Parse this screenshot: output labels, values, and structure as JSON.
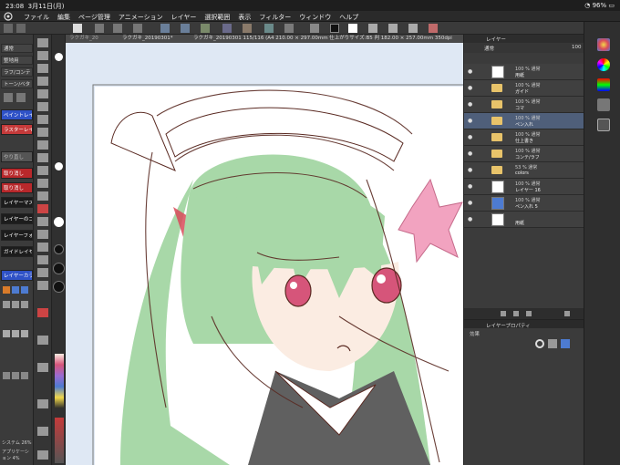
{
  "status": {
    "time": "23:08",
    "date": "3月11日(月)",
    "battery": "96%"
  },
  "menu": [
    "ファイル",
    "編集",
    "ページ管理",
    "アニメーション",
    "レイヤー",
    "選択範囲",
    "表示",
    "フィルター",
    "ウィンドウ",
    "ヘルプ"
  ],
  "left_panel": {
    "rows": [
      "通常",
      "整地用",
      "ラフ/コンテ",
      "トーン/ベタ"
    ],
    "buttons": [
      {
        "label": "ペイントレイヤー",
        "bg": "#2f52c7",
        "fg": "#ffffff"
      },
      {
        "label": "ラスターレイヤー",
        "bg": "#c43a3a",
        "fg": "#ffffff"
      },
      {
        "label": "やり直し",
        "bg": "#555555",
        "fg": "#bbbbbb"
      },
      {
        "label": "取り消し",
        "bg": "#b8282b",
        "fg": "#ffffff"
      },
      {
        "label": "取り消し",
        "bg": "#b8282b",
        "fg": "#ffffff"
      },
      {
        "label": "レイヤーマスク",
        "bg": "#1c1c1c",
        "fg": "#ffffff"
      },
      {
        "label": "レイヤーのコピー",
        "bg": "#1c1c1c",
        "fg": "#ffffff"
      },
      {
        "label": "レイヤーフォルダ",
        "bg": "#1c1c1c",
        "fg": "#ffffff"
      },
      {
        "label": "ガイドレイヤー",
        "bg": "#1c1c1c",
        "fg": "#ffffff"
      },
      {
        "label": "レイヤーカラー",
        "bg": "#2f52c7",
        "fg": "#ffffff"
      }
    ],
    "bottom": [
      "システム 26%",
      "アプリケーション 4%"
    ]
  },
  "canvas_bar": {
    "tabs": [
      "ラクガキ_20",
      "ラクガキ_20190301*"
    ],
    "info": "ラクガキ_20190301 115/116 (A4 210.00 × 297.00mm 仕上がりサイズ:B5 判 182.00 × 257.00mm 350dpi 92.5%)"
  },
  "layers": [
    {
      "opacity": "100 % 通常",
      "name": "用紙",
      "type": "layer"
    },
    {
      "opacity": "100 % 通常",
      "name": "ガイド",
      "type": "folder"
    },
    {
      "opacity": "100 % 通常",
      "name": "コマ",
      "type": "folder"
    },
    {
      "opacity": "100 % 通常",
      "name": "ペン入れ",
      "type": "folder"
    },
    {
      "opacity": "100 % 通常",
      "name": "仕上書き",
      "type": "folder"
    },
    {
      "opacity": "100 % 通常",
      "name": "コンテ/ラフ",
      "type": "folder"
    },
    {
      "opacity": "53 % 通常",
      "name": "colors",
      "type": "folder"
    },
    {
      "opacity": "100 % 通常",
      "name": "レイヤー 16",
      "type": "layer"
    },
    {
      "opacity": "100 % 通常",
      "name": "ペン入れ 5",
      "type": "layer"
    },
    {
      "opacity": "",
      "name": "用紙",
      "type": "layer"
    }
  ],
  "layer_tab": "レイヤー",
  "props_title": "レイヤープロパティ",
  "props_label": "効果",
  "opacity_value": "100",
  "blend": "通常",
  "colors": {
    "hair": "#a8d8a8",
    "hair_dark": "#7fbf85",
    "skin": "#fbece2",
    "eye": "#d6557a",
    "ribbon": "#f2a3c0",
    "line": "#5a2a22",
    "dress": "#606060"
  }
}
